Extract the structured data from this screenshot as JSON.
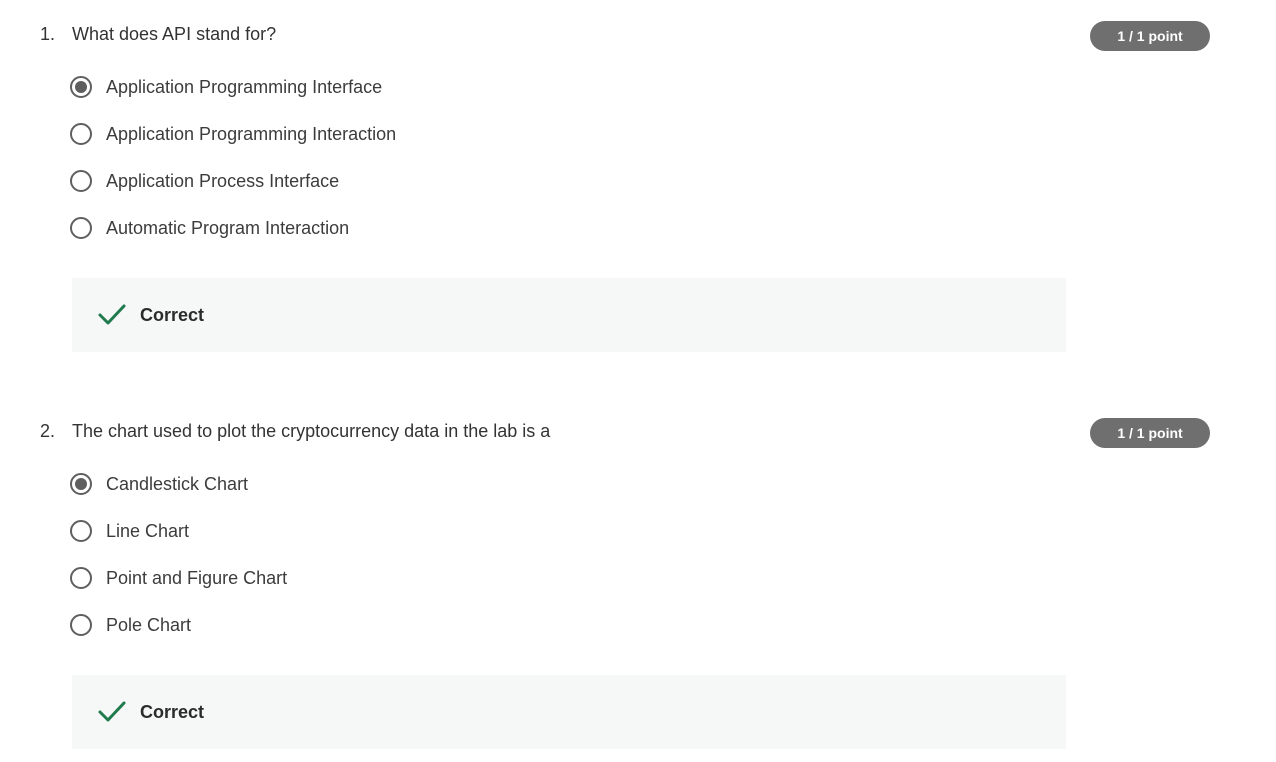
{
  "questions": [
    {
      "number": "1.",
      "prompt": "What does API stand for?",
      "points": "1 / 1 point",
      "options": [
        {
          "label": "Application Programming Interface",
          "selected": true
        },
        {
          "label": "Application Programming Interaction",
          "selected": false
        },
        {
          "label": "Application Process Interface",
          "selected": false
        },
        {
          "label": "Automatic Program Interaction",
          "selected": false
        }
      ],
      "feedback": {
        "label": "Correct",
        "icon": "checkmark-icon",
        "color": "#1f7a4d"
      }
    },
    {
      "number": "2.",
      "prompt": "The chart used to plot the cryptocurrency data in the lab is a",
      "points": "1 / 1 point",
      "options": [
        {
          "label": "Candlestick Chart",
          "selected": true
        },
        {
          "label": "Line Chart",
          "selected": false
        },
        {
          "label": "Point and Figure Chart",
          "selected": false
        },
        {
          "label": "Pole Chart",
          "selected": false
        }
      ],
      "feedback": {
        "label": "Correct",
        "icon": "checkmark-icon",
        "color": "#1f7a4d"
      }
    }
  ]
}
